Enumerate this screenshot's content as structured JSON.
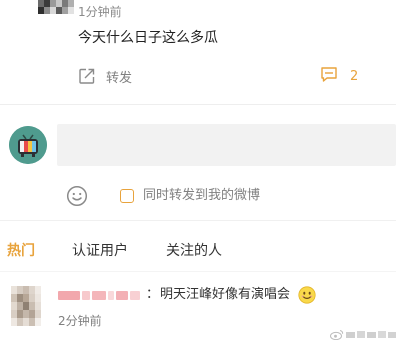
{
  "post": {
    "time": "1分钟前",
    "text": "今天什么日子这么多瓜",
    "repost_label": "转发",
    "comment_count": "2"
  },
  "composer": {
    "placeholder": "",
    "repost_option_label": "同时转发到我的微博"
  },
  "tabs": [
    {
      "label": "热门",
      "active": true
    },
    {
      "label": "认证用户",
      "active": false
    },
    {
      "label": "关注的人",
      "active": false
    }
  ],
  "comments": [
    {
      "separator": "：",
      "text": "明天汪峰好像有演唱会",
      "emoji": "smile-emoji",
      "time": "2分钟前"
    }
  ],
  "icons": {
    "repost": "repost-icon",
    "comment": "comment-icon",
    "emoji": "emoji-face-icon",
    "checkbox": "checkbox-icon"
  },
  "colors": {
    "accent": "#e8a33c",
    "muted_text": "#808080",
    "input_bg": "#f2f2f2"
  }
}
